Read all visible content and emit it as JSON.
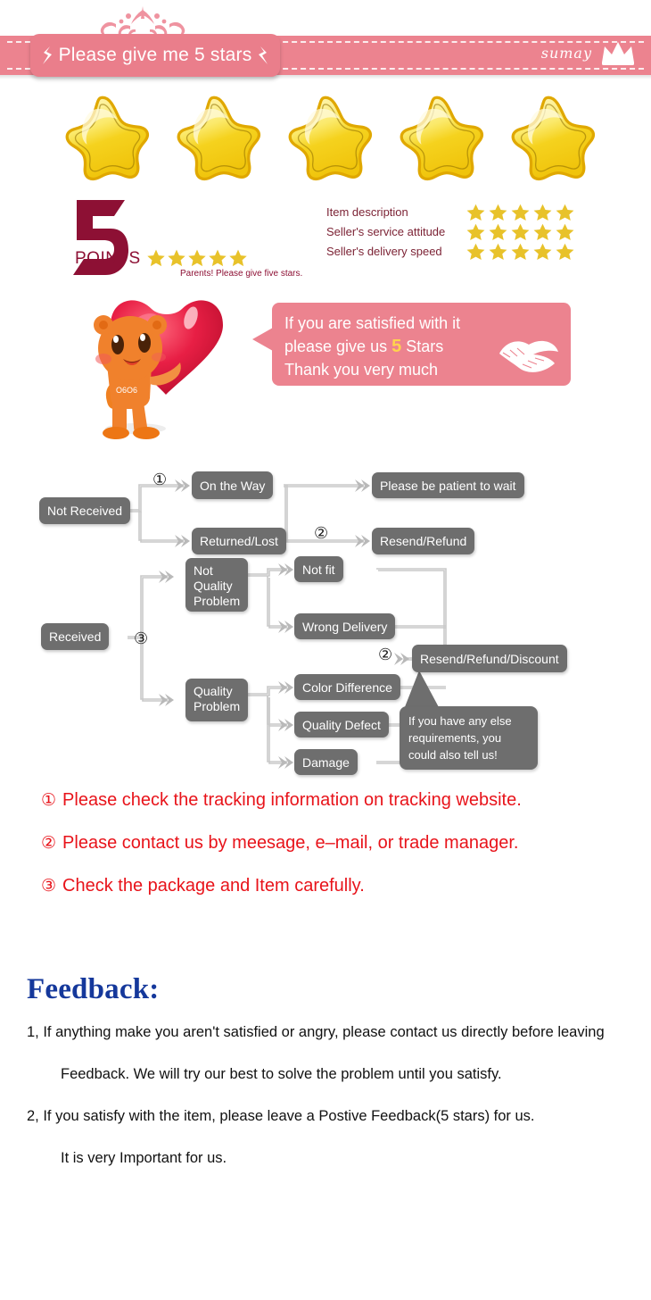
{
  "header": {
    "pill_title": "Please give me 5 stars",
    "brand_name": "sumay",
    "tiara_icon": "tiara-ornament-icon",
    "crown_icon": "crown-icon",
    "fleur_left_icon": "fleur-ornament-icon",
    "fleur_right_icon": "fleur-ornament-icon",
    "band_color": "#ec838f",
    "pill_color": "#ea7e8b"
  },
  "big_stars": {
    "count": 5,
    "star_icon": "star-icon",
    "color": "#f5d21e"
  },
  "points": {
    "number": "5",
    "word": "POINTS",
    "note": "Parents! Please give five stars.",
    "star_count": 5,
    "color": "#8d1034"
  },
  "ratings": {
    "rows": [
      {
        "label": "Item description",
        "stars": 5
      },
      {
        "label": "Seller's service attitude",
        "stars": 5
      },
      {
        "label": "Seller's delivery speed",
        "stars": 5
      }
    ],
    "label_color": "#7c2335",
    "star_color": "#e8c22a"
  },
  "bubble": {
    "line1": "If you are satisfied with it",
    "line2_pre": "please give us",
    "line2_highlight": "5",
    "line2_post": "Stars",
    "line3": "Thank you very much",
    "lips_icon": "lips-kiss-icon",
    "mascot_icon": "bear-holding-heart-icon",
    "background": "#ec838f",
    "highlight_color": "#ffd34d"
  },
  "flowchart": {
    "box_color": "#6e6e6e",
    "boxes": {
      "not_received": "Not Received",
      "on_the_way": "On the Way",
      "returned_lost": "Returned/Lost",
      "be_patient": "Please be patient to wait",
      "resend_refund": "Resend/Refund",
      "received": "Received",
      "not_quality_problem": "Not\nQuality\nProblem",
      "quality_problem": "Quality\nProblem",
      "not_fit": "Not fit",
      "wrong_delivery": "Wrong Delivery",
      "color_difference": "Color Difference",
      "quality_defect": "Quality Defect",
      "damage": "Damage",
      "resend_refund_discount": "Resend/Refund/Discount"
    },
    "callout": "If you have any else requirements, you could also tell us!",
    "markers": {
      "m1": "①",
      "m2_top": "②",
      "m3": "③",
      "m2_bottom": "②"
    }
  },
  "red_list": {
    "color": "#e8131a",
    "items": [
      {
        "num": "①",
        "text": "Please check the tracking information on tracking website."
      },
      {
        "num": "②",
        "text": "Please contact us by meesage, e–mail, or trade manager."
      },
      {
        "num": "③",
        "text": "Check the package and Item carefully."
      }
    ]
  },
  "feedback": {
    "title": "Feedback:",
    "title_color": "#15389b",
    "lines": [
      {
        "text": "1, If anything make you aren't satisfied or angry, please contact us directly before leaving",
        "indent": false
      },
      {
        "text": "Feedback. We will try our best to solve the problem until you satisfy.",
        "indent": true
      },
      {
        "text": "2, If you satisfy with the item, please leave a Postive Feedback(5 stars) for us.",
        "indent": false
      },
      {
        "text": "It is very Important for us.",
        "indent": true
      }
    ]
  }
}
